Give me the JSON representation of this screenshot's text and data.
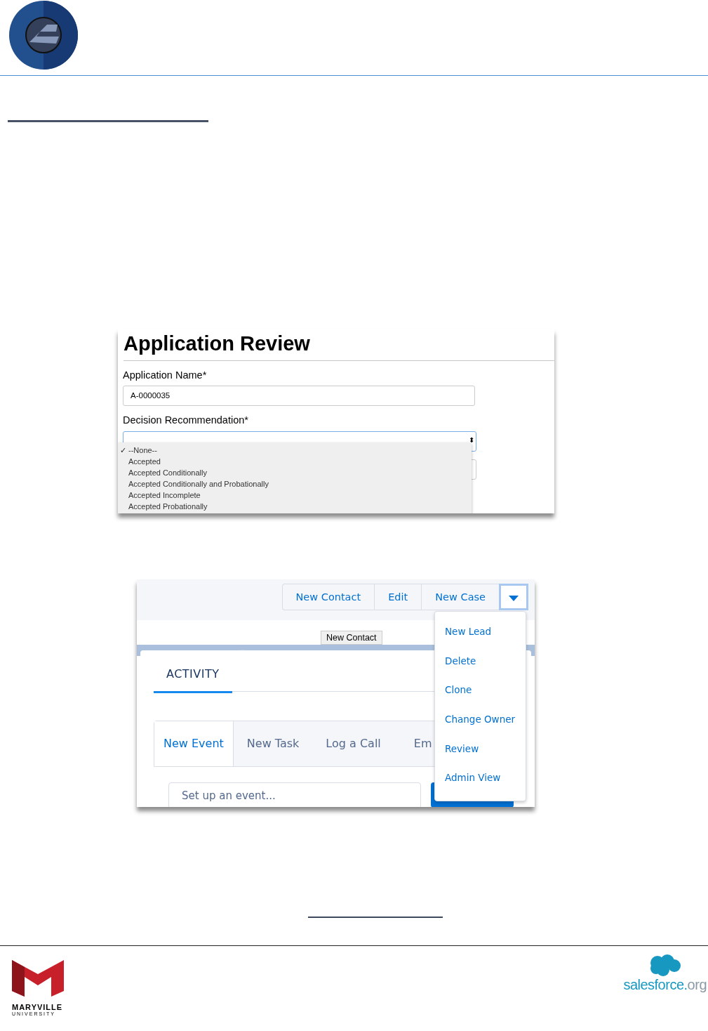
{
  "application_review": {
    "title": "Application Review",
    "fields": [
      {
        "label": "Application Name*",
        "value": "A-0000035"
      }
    ],
    "dropdown": {
      "label": "Decision Recommendation*",
      "arrows": "⬍",
      "check_mark": "✓",
      "options": [
        {
          "label": "--None--",
          "selected": true
        },
        {
          "label": "Accepted",
          "selected": false
        },
        {
          "label": "Accepted Conditionally",
          "selected": false
        },
        {
          "label": "Accepted Conditionally and Probationally",
          "selected": false
        },
        {
          "label": "Accepted Incomplete",
          "selected": false
        },
        {
          "label": "Accepted Probationally",
          "selected": false
        }
      ]
    }
  },
  "record_page": {
    "actions": [
      {
        "label": "New Contact"
      },
      {
        "label": "Edit"
      },
      {
        "label": "New Case"
      }
    ],
    "menu_open": true,
    "tooltip": "New Contact",
    "menu": [
      {
        "label": "New Lead"
      },
      {
        "label": "Delete"
      },
      {
        "label": "Clone"
      },
      {
        "label": "Change Owner"
      },
      {
        "label": "Review"
      },
      {
        "label": "Admin View"
      }
    ],
    "tab": "ACTIVITY",
    "composer_tabs": [
      {
        "label": "New Event",
        "selected": true
      },
      {
        "label": "New Task",
        "selected": false
      },
      {
        "label": "Log a Call",
        "selected": false
      },
      {
        "label": "Em",
        "selected": false
      }
    ],
    "placeholder": "Set up an event..."
  },
  "footer": {
    "university": "MARYVILLE",
    "university_sub": "UNIVERSITY",
    "partner": "salesforce.",
    "partner_suffix": "org"
  }
}
